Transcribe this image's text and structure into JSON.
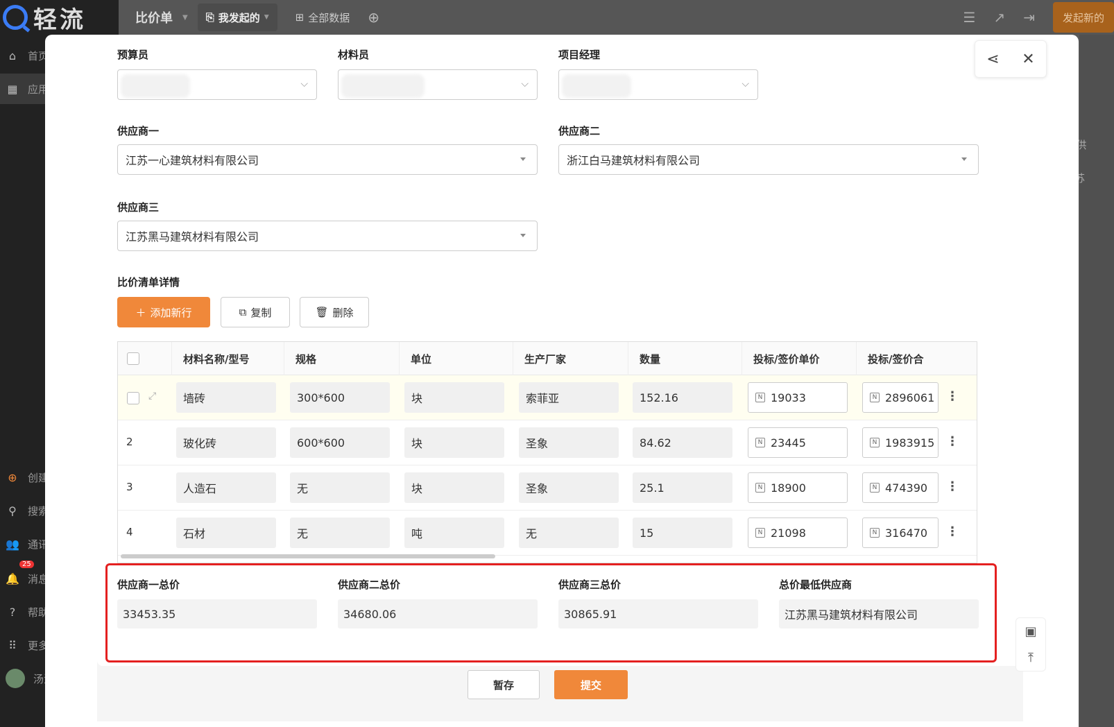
{
  "app": {
    "name": "轻流"
  },
  "sidebar": {
    "items": [
      {
        "label": "首页",
        "icon": "home-icon"
      },
      {
        "label": "应用",
        "icon": "apps-icon"
      },
      {
        "label": "创建",
        "icon": "plus-circle-icon"
      },
      {
        "label": "搜索",
        "icon": "search-icon"
      },
      {
        "label": "通讯录",
        "icon": "contacts-icon"
      },
      {
        "label": "消息",
        "icon": "bell-icon",
        "badge": "25"
      },
      {
        "label": "帮助",
        "icon": "help-icon"
      },
      {
        "label": "更多",
        "icon": "grid-icon"
      },
      {
        "label": "汤洁",
        "icon": "avatar"
      }
    ]
  },
  "topbar": {
    "title": "比价单",
    "tabs": [
      {
        "label": "我发起的",
        "active": true
      },
      {
        "label": "全部数据",
        "active": false
      }
    ],
    "new_button": "发起新的"
  },
  "form": {
    "budgeter": {
      "label": "预算员"
    },
    "material_clerk": {
      "label": "材料员"
    },
    "project_manager": {
      "label": "项目经理"
    },
    "supplier1": {
      "label": "供应商一",
      "value": "江苏一心建筑材料有限公司"
    },
    "supplier2": {
      "label": "供应商二",
      "value": "浙江白马建筑材料有限公司"
    },
    "supplier3": {
      "label": "供应商三",
      "value": "江苏黑马建筑材料有限公司"
    },
    "detail_title": "比价清单详情",
    "actions": {
      "add": "添加新行",
      "copy": "复制",
      "delete": "删除"
    }
  },
  "table": {
    "headers": [
      "材料名称/型号",
      "规格",
      "单位",
      "生产厂家",
      "数量",
      "投标/签价单价",
      "投标/签价合"
    ],
    "rows": [
      {
        "index": "",
        "name": "墙砖",
        "spec": "300*600",
        "unit": "块",
        "maker": "索菲亚",
        "qty": "152.16",
        "price": "19033",
        "total": "2896061"
      },
      {
        "index": "2",
        "name": "玻化砖",
        "spec": "600*600",
        "unit": "块",
        "maker": "圣象",
        "qty": "84.62",
        "price": "23445",
        "total": "1983915"
      },
      {
        "index": "3",
        "name": "人造石",
        "spec": "无",
        "unit": "块",
        "maker": "圣象",
        "qty": "25.1",
        "price": "18900",
        "total": "474390"
      },
      {
        "index": "4",
        "name": "石材",
        "spec": "无",
        "unit": "吨",
        "maker": "无",
        "qty": "15",
        "price": "21098",
        "total": "316470"
      }
    ]
  },
  "totals": {
    "s1": {
      "label": "供应商一总价",
      "value": "33453.35"
    },
    "s2": {
      "label": "供应商二总价",
      "value": "34680.06"
    },
    "s3": {
      "label": "供应商三总价",
      "value": "30865.91"
    },
    "lowest": {
      "label": "总价最低供应商",
      "value": "江苏黑马建筑材料有限公司"
    }
  },
  "footer": {
    "save": "暂存",
    "submit": "提交"
  },
  "colors": {
    "accent": "#f0883a",
    "highlight": "#e42020"
  }
}
